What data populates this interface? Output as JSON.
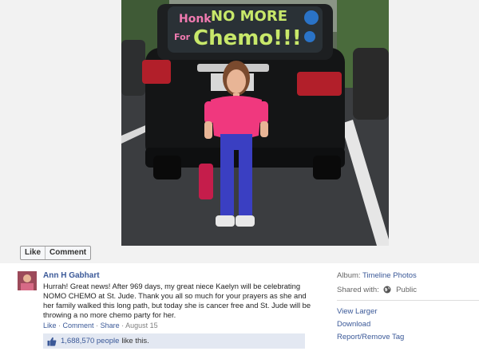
{
  "photo": {
    "window_sign_lines": [
      "Honk",
      "NO MORE",
      "For",
      "Chemo!!!"
    ]
  },
  "actions": {
    "like_label": "Like",
    "comment_label": "Comment"
  },
  "post": {
    "author": "Ann H Gabhart",
    "message": "Hurrah! Great news! After 969 days, my great niece Kaelyn will be celebrating NOMO CHEMO at St. Jude. Thank you all so much for your prayers as she and her family walked this long path, but today she is cancer free and St. Jude will be throwing a no more chemo party for her.",
    "like_link": "Like",
    "comment_link": "Comment",
    "share_link": "Share",
    "date": "August 15",
    "separator": "·",
    "likes_count": "1,688,570 people",
    "likes_tail": "like this."
  },
  "sidebar": {
    "album_label": "Album:",
    "album_name": "Timeline Photos",
    "shared_label": "Shared with:",
    "shared_value": "Public",
    "view_larger": "View Larger",
    "download": "Download",
    "report": "Report/Remove Tag"
  },
  "colors": {
    "link_blue": "#3b5998",
    "likes_bg": "#e3e8f2",
    "shirt_pink": "#f0387e"
  },
  "icons": {
    "thumb": "thumbs-up-icon",
    "globe": "globe-icon"
  }
}
